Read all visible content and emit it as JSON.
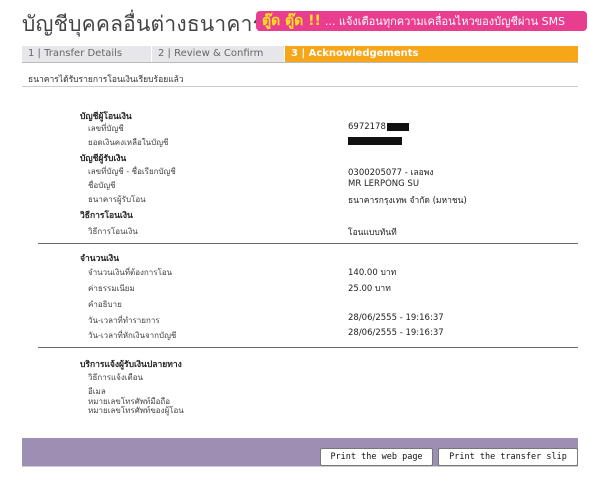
{
  "header": {
    "title": "บัญชีบุคคลอื่นต่างธนาคาร",
    "banner_highlight": "ตู๊ด ตู๊ด !!",
    "banner_text": "... แจ้งเตือนทุกความเคลื่อนไหวของบัญชีผ่าน SMS"
  },
  "steps": [
    {
      "label": "1 | Transfer Details"
    },
    {
      "label": "2 | Review & Confirm"
    },
    {
      "label": "3 | Acknowledgements"
    }
  ],
  "notice": "ธนาคารได้รับรายการโอนเงินเรียบร้อยแล้ว",
  "from": {
    "heading": "บัญชีผู้โอนเงิน",
    "account_label": "เลขที่บัญชี",
    "account_value": "6972178",
    "balance_label": "ยอดเงินคงเหลือในบัญชี"
  },
  "to": {
    "heading": "บัญชีผู้รับเงิน",
    "account_label": "เลขที่บัญชี - ชื่อเรียกบัญชี",
    "account_value": "0300205077 - เลอพง",
    "name_label": "ชื่อบัญชี",
    "name_value": "MR LERPONG SU",
    "bank_label": "ธนาคารผู้รับโอน",
    "bank_value": "ธนาคารกรุงเทพ จำกัด (มหาชน)"
  },
  "method": {
    "heading": "วิธีการโอนเงิน",
    "label": "วิธีการโอนเงิน",
    "value": "โอนแบบทันที"
  },
  "amount": {
    "heading": "จำนวนเงิน",
    "amount_label": "จำนวนเงินที่ต้องการโอน",
    "amount_value": "140.00 บาท",
    "fee_label": "ค่าธรรมเนียม",
    "fee_value": "25.00  บาท",
    "desc_label": "คำอธิบาย",
    "txdate_label": "วัน-เวลาที่ทำรายการ",
    "txdate_value": "28/06/2555 - 19:16:37",
    "debit_label": "วัน-เวลาที่หักเงินจากบัญชี",
    "debit_value": "28/06/2555 - 19:16:37"
  },
  "notify": {
    "heading": "บริการแจ้งผู้รับเงินปลายทาง",
    "method_label": "วิธีการแจ้งเตือน",
    "email_label": "อีเมล",
    "mobile_label": "หมายเลขโทรศัพท์มือถือ",
    "sender_mobile_label": "หมายเลขโทรศัพท์ของผู้โอน"
  },
  "buttons": {
    "print_page": "Print the web page",
    "print_slip": "Print the transfer slip"
  },
  "colors": {
    "active_step": "#f5a619",
    "banner": "#e93d8f",
    "footer": "#9c8fb3"
  }
}
